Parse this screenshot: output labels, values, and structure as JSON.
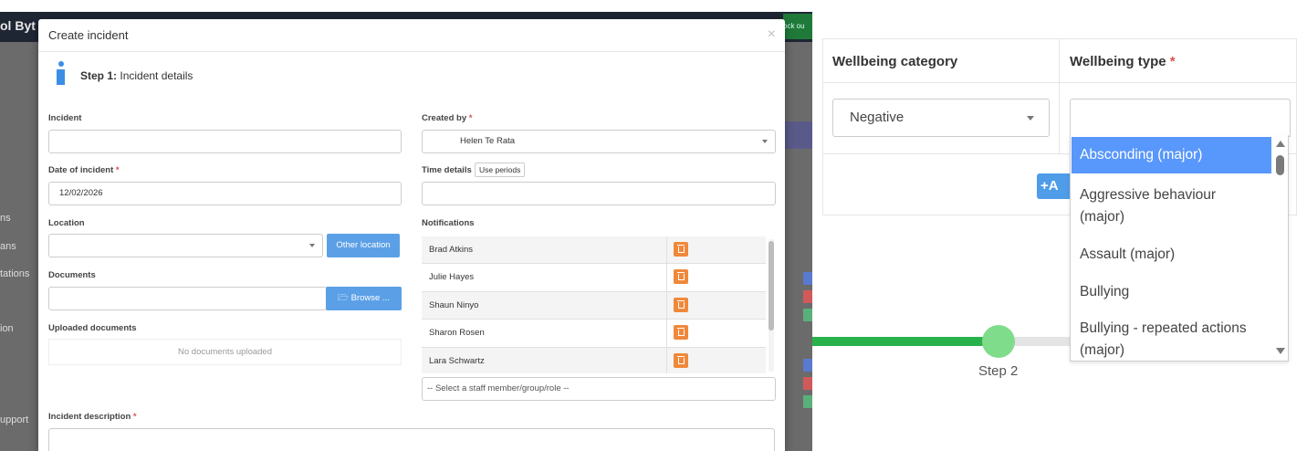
{
  "background_app": {
    "brand_partial": "ol Byt",
    "top_button_partial": "ock ou",
    "side_words": [
      "ns",
      "ans",
      "tations",
      "ion",
      "upport"
    ]
  },
  "modal": {
    "title": "Create incident",
    "close_icon": "×",
    "step_number": "Step 1:",
    "step_title": "Incident details",
    "incident_label": "Incident",
    "incident_value": "",
    "created_by_label": "Created by",
    "created_by_value": "Helen Te Rata",
    "date_label": "Date of incident",
    "date_value": "12/02/2026",
    "time_label": "Time details",
    "use_periods_button": "Use periods",
    "time_value": "",
    "location_label": "Location",
    "location_value": "",
    "other_location_button": "Other location",
    "notifications_label": "Notifications",
    "notifications": [
      {
        "name": "Brad Atkins"
      },
      {
        "name": "Julie Hayes"
      },
      {
        "name": "Shaun Ninyo"
      },
      {
        "name": "Sharon Rosen"
      },
      {
        "name": "Lara Schwartz"
      }
    ],
    "staff_select_placeholder": "-- Select a staff member/group/role --",
    "documents_label": "Documents",
    "browse_button": "🗁 Browse ...",
    "uploaded_documents_label": "Uploaded documents",
    "no_documents_text": "No documents uploaded",
    "description_label": "Incident description",
    "required_mark": "*"
  },
  "wellbeing": {
    "category_header": "Wellbeing category",
    "type_header": "Wellbeing type",
    "required_mark": "*",
    "category_value": "Negative",
    "type_value": "",
    "add_button_partial": "+A",
    "dropdown_options": [
      "Absconding (major)",
      "Aggressive behaviour (major)",
      "Assault (major)",
      "Bullying",
      "Bullying - repeated actions (major)"
    ],
    "selected_option": "Absconding (major)",
    "step_label": "Step 2"
  },
  "colors": {
    "accent_blue": "#5ba0e6",
    "trash_orange": "#f0883a",
    "progress_green": "#28b24b",
    "dropdown_highlight": "#5897fb"
  }
}
